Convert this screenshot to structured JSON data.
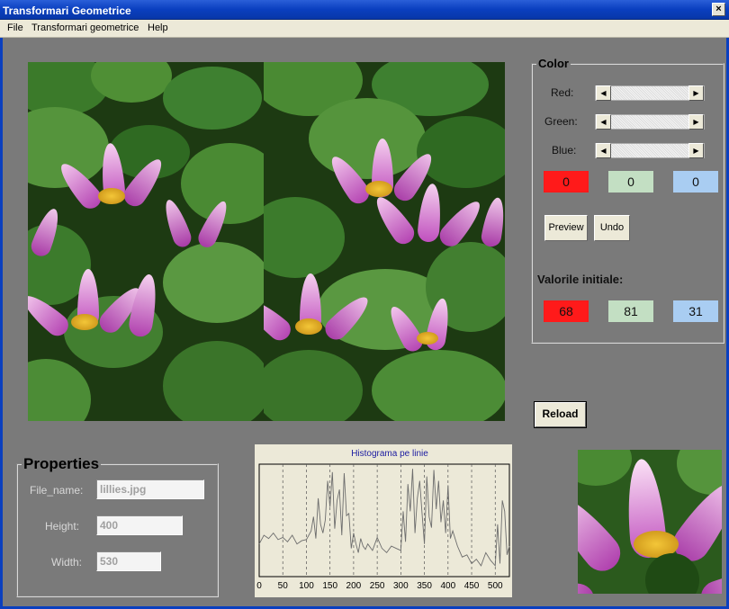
{
  "window": {
    "title": "Transformari Geometrice",
    "close_glyph": "×"
  },
  "menu": [
    "File",
    "Transformari geometrice",
    "Help"
  ],
  "color_panel": {
    "title": "Color",
    "sliders": [
      {
        "label": "Red:"
      },
      {
        "label": "Green:"
      },
      {
        "label": "Blue:"
      }
    ],
    "values": {
      "red": "0",
      "green": "0",
      "blue": "0"
    },
    "preview_label": "Preview",
    "undo_label": "Undo",
    "initial_title": "Valorile initiale:",
    "initial": {
      "red": "68",
      "green": "81",
      "blue": "31"
    }
  },
  "reload_label": "Reload",
  "properties": {
    "title": "Properties",
    "file_label": "File_name:",
    "file_value": "lillies.jpg",
    "height_label": "Height:",
    "height_value": "400",
    "width_label": "Width:",
    "width_value": "530"
  },
  "histogram": {
    "title": "Histograma pe linie",
    "ticks": [
      "0",
      "50",
      "100",
      "150",
      "200",
      "250",
      "300",
      "350",
      "400",
      "450",
      "500"
    ]
  },
  "colors": {
    "red_box": "#ff1a1a",
    "green_box": "#c3dfc3",
    "blue_box": "#a9cdf2",
    "title_text": "#1a1aa0",
    "hist_line": "#6d6d6d"
  },
  "chart_data": {
    "type": "line",
    "title": "Histograma pe linie",
    "xlabel": "",
    "ylabel": "",
    "xlim": [
      0,
      530
    ],
    "x": [
      0,
      10,
      20,
      30,
      40,
      50,
      60,
      70,
      80,
      90,
      100,
      110,
      115,
      120,
      125,
      130,
      135,
      140,
      145,
      150,
      155,
      160,
      165,
      170,
      175,
      180,
      185,
      190,
      195,
      200,
      205,
      210,
      215,
      220,
      225,
      230,
      240,
      250,
      260,
      270,
      280,
      290,
      300,
      305,
      310,
      315,
      320,
      325,
      330,
      335,
      340,
      345,
      350,
      355,
      360,
      365,
      370,
      375,
      380,
      385,
      390,
      395,
      400,
      405,
      410,
      420,
      430,
      440,
      450,
      460,
      470,
      480,
      490,
      500,
      505,
      510,
      515,
      520,
      525,
      530
    ],
    "values": [
      30,
      38,
      35,
      40,
      34,
      36,
      32,
      38,
      30,
      33,
      34,
      42,
      55,
      35,
      72,
      48,
      40,
      52,
      88,
      64,
      96,
      44,
      70,
      80,
      38,
      95,
      56,
      58,
      26,
      40,
      30,
      22,
      35,
      28,
      25,
      30,
      24,
      36,
      26,
      22,
      28,
      26,
      24,
      60,
      32,
      85,
      60,
      99,
      40,
      72,
      88,
      58,
      30,
      92,
      55,
      45,
      98,
      62,
      88,
      50,
      70,
      40,
      84,
      35,
      42,
      28,
      18,
      20,
      12,
      16,
      10,
      22,
      15,
      10,
      48,
      12,
      70,
      60,
      20,
      28
    ]
  }
}
